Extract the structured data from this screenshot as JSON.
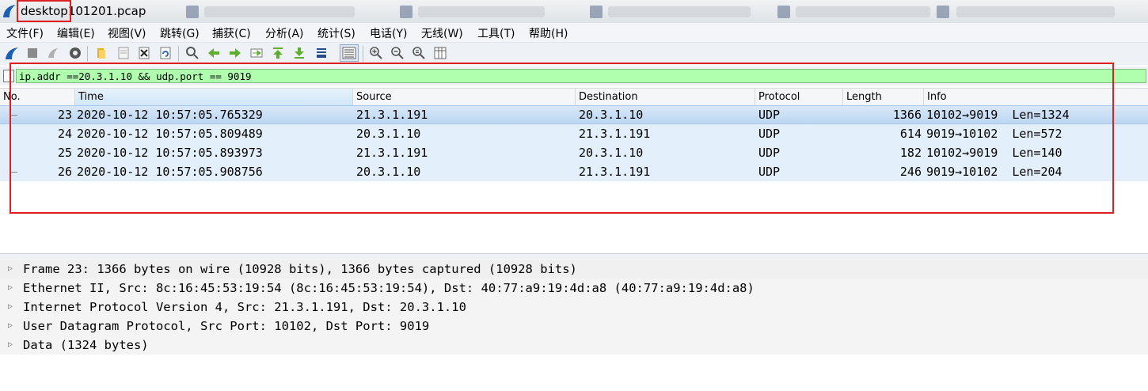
{
  "window": {
    "title": "desktop101201.pcap"
  },
  "menu": {
    "items": [
      "文件(F)",
      "编辑(E)",
      "视图(V)",
      "跳转(G)",
      "捕获(C)",
      "分析(A)",
      "统计(S)",
      "电话(Y)",
      "无线(W)",
      "工具(T)",
      "帮助(H)"
    ]
  },
  "filter": {
    "value": "ip.addr ==20.3.1.10 && udp.port == 9019",
    "color": "#afffaf"
  },
  "packet_list": {
    "columns": [
      "No.",
      "Time",
      "Source",
      "Destination",
      "Protocol",
      "Length",
      "Info"
    ],
    "rows": [
      {
        "no": "23",
        "time": "2020-10-12 10:57:05.765329",
        "source": "21.3.1.191",
        "destination": "20.3.1.10",
        "protocol": "UDP",
        "length": "1366",
        "info": "10102→9019  Len=1324"
      },
      {
        "no": "24",
        "time": "2020-10-12 10:57:05.809489",
        "source": "20.3.1.10",
        "destination": "21.3.1.191",
        "protocol": "UDP",
        "length": "614",
        "info": "9019→10102  Len=572"
      },
      {
        "no": "25",
        "time": "2020-10-12 10:57:05.893973",
        "source": "21.3.1.191",
        "destination": "20.3.1.10",
        "protocol": "UDP",
        "length": "182",
        "info": "10102→9019  Len=140"
      },
      {
        "no": "26",
        "time": "2020-10-12 10:57:05.908756",
        "source": "20.3.1.10",
        "destination": "21.3.1.191",
        "protocol": "UDP",
        "length": "246",
        "info": "9019→10102  Len=204"
      }
    ]
  },
  "details": {
    "rows": [
      "Frame 23: 1366 bytes on wire (10928 bits), 1366 bytes captured (10928 bits)",
      "Ethernet II, Src: 8c:16:45:53:19:54 (8c:16:45:53:19:54), Dst: 40:77:a9:19:4d:a8 (40:77:a9:19:4d:a8)",
      "Internet Protocol Version 4, Src: 21.3.1.191, Dst: 20.3.1.10",
      "User Datagram Protocol, Src Port: 10102, Dst Port: 9019",
      "Data (1324 bytes)"
    ]
  },
  "colors": {
    "annotation": "#e02020",
    "row_background": "#e3f0fb"
  },
  "toolbar_icons": [
    "shark-fin-start-icon",
    "stop-icon",
    "restart-icon",
    "capture-options-icon",
    "open-file-icon",
    "save-file-icon",
    "close-file-icon",
    "reload-icon",
    "find-icon",
    "go-back-icon",
    "go-forward-icon",
    "go-to-packet-icon",
    "go-first-icon",
    "go-last-icon",
    "autoscroll-icon",
    "colorize-icon",
    "zoom-in-icon",
    "zoom-out-icon",
    "zoom-normal-icon",
    "resize-columns-icon"
  ]
}
